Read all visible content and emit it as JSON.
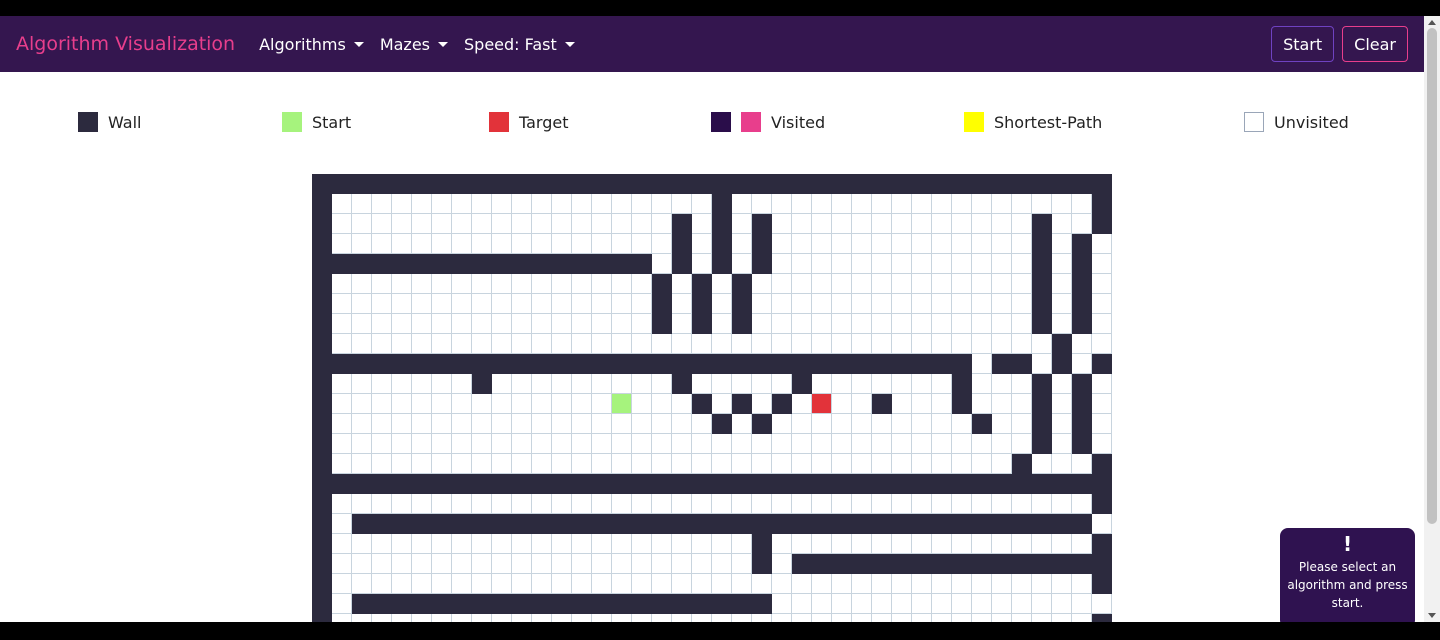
{
  "navbar": {
    "brand": "Algorithm Visualization",
    "menus": [
      "Algorithms",
      "Mazes",
      "Speed: Fast"
    ],
    "start_label": "Start",
    "clear_label": "Clear"
  },
  "legend": [
    {
      "label": "Wall",
      "colors": [
        "#2c2a3e"
      ]
    },
    {
      "label": "Start",
      "colors": [
        "#a6f37d"
      ]
    },
    {
      "label": "Target",
      "colors": [
        "#e2333a"
      ]
    },
    {
      "label": "Visited",
      "colors": [
        "#2a0d4a",
        "#e83e8c"
      ]
    },
    {
      "label": "Shortest-Path",
      "colors": [
        "#ffff00"
      ]
    },
    {
      "label": "Unvisited",
      "colors": [
        "#ffffff"
      ]
    }
  ],
  "grid": {
    "cols": 40,
    "visible_rows": 23,
    "start": [
      11,
      15
    ],
    "target": [
      11,
      25
    ],
    "rows": [
      "########################################",
      "#...................#..................#",
      "#.................#.#.#.............#..#",
      "#.................#.#.#.............#.#.",
      "#################.#.#.#.............#.#.",
      "#................#.#.#..............#.#.",
      "#................#.#.#..............#.#.",
      "#................#.#.#..............#.#.",
      "#....................................#..",
      "#################################.##.#.#",
      "#.......#.........#.....#.......#...#.#.",
      "#..................#.#.#....#...#...#.#.",
      "#...................#.#..........#..#.#.",
      "#...................................#.#.",
      "#..................................#...#",
      "###########################################",
      "#......................................#",
      "#.#####################################",
      "#.....................#................#",
      "#.....................#.################",
      "#......................................#",
      "#.#####################......................",
      "#......................................#"
    ]
  },
  "toast": {
    "icon": "!",
    "message": "Please select an algorithm and press start."
  }
}
